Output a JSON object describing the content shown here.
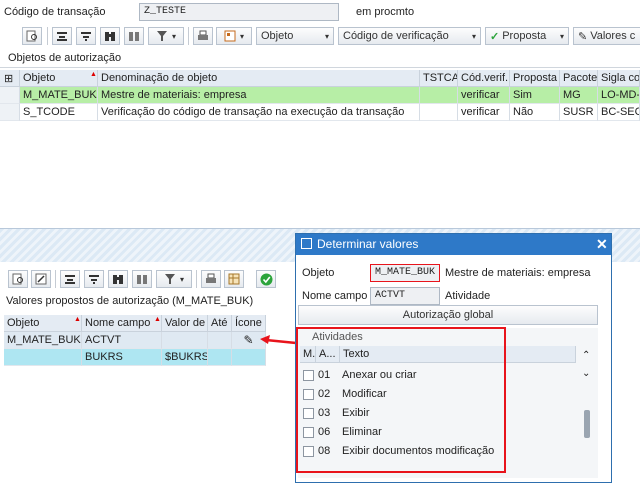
{
  "header": {
    "label_transaction": "Código de transação",
    "transaction_value": "Z_TESTE",
    "status_text": "em procmto"
  },
  "toolbar1": {
    "object_dropdown": "Objeto",
    "verif_dropdown": "Código de verificação",
    "proposal_button": "Proposta",
    "values_button": "Valores c"
  },
  "auth_objects": {
    "section_title": "Objetos de autorização",
    "columns": [
      "Objeto",
      "Denominação de objeto",
      "TSTCA",
      "Cód.verif.",
      "Proposta",
      "Pacote",
      "Sigla co"
    ],
    "rows": [
      [
        "M_MATE_BUK",
        "Mestre de materiais: empresa",
        "",
        "verificar",
        "Sim",
        "MG",
        "LO-MD-I"
      ],
      [
        "S_TCODE",
        "Verificação do código de transação na execução da transação",
        "",
        "verificar",
        "Não",
        "SUSR",
        "BC-SEC-"
      ]
    ]
  },
  "proposals": {
    "section_title": "Valores propostos de autorização (M_MATE_BUK)",
    "columns": [
      "Objeto",
      "Nome campo",
      "Valor de",
      "Até",
      "Ícone"
    ],
    "rows": [
      [
        "M_MATE_BUK",
        "ACTVT",
        "",
        "",
        ""
      ],
      [
        "",
        "BUKRS",
        "$BUKRS",
        "",
        ""
      ]
    ]
  },
  "dialog": {
    "title": "Determinar valores",
    "object_label": "Objeto",
    "object_value": "M_MATE_BUK",
    "object_desc": "Mestre de materiais: empresa",
    "field_label": "Nome campo",
    "field_value": "ACTVT",
    "field_desc": "Atividade",
    "global_button": "Autorização global",
    "group_title": "Atividades",
    "col_m": "M.",
    "col_a": "A...",
    "col_text": "Texto",
    "activities": [
      {
        "code": "01",
        "text": "Anexar ou criar"
      },
      {
        "code": "02",
        "text": "Modificar"
      },
      {
        "code": "03",
        "text": "Exibir"
      },
      {
        "code": "06",
        "text": "Eliminar"
      },
      {
        "code": "08",
        "text": "Exibir documentos modificação"
      }
    ]
  },
  "colors": {
    "highlight_green": "#b7eea6",
    "selection_cyan": "#aee6f2",
    "dialog_blue": "#2e79c8",
    "annotation_red": "#e8141c",
    "ok_green": "#2ca43b"
  },
  "icons": [
    "find-icon",
    "sort-asc-icon",
    "sort-desc-icon",
    "binoculars-icon",
    "filter-icon",
    "print-icon",
    "layout-icon",
    "edit-icon",
    "ok-icon",
    "close-icon",
    "dialog-icon",
    "pencil-icon"
  ]
}
